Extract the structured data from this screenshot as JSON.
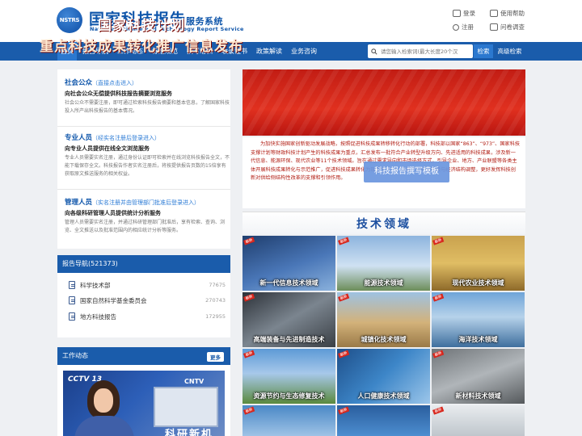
{
  "header": {
    "logo_text": "NSTRS",
    "title_main": "国家科技报告",
    "title_small": "服务系统",
    "subtitle": "National Science and Technology Report Service",
    "links": {
      "login": "登录",
      "help": "使用帮助",
      "register": "注册",
      "survey": "问卷调查"
    }
  },
  "nav": {
    "items": [
      "首页",
      "报告导航",
      "工作动态",
      "标准规范",
      "撰写培训",
      "收录证书",
      "政策解读",
      "业务咨询"
    ],
    "search_placeholder": "请您输入检索词(最大长度20个汉",
    "search_label": "检索",
    "advanced_label": "高级检索"
  },
  "access": {
    "public": {
      "title": "社会公众",
      "note": "（直接点击进入）",
      "head": "向社会公众无偿提供科技报告摘要浏览服务",
      "text": "社会公众不需要注册，即可通过检索科技报告摘要和基本信息，了解国家科技投入所产出科技报告的基本情况。"
    },
    "professional": {
      "title": "专业人员",
      "note": "（经实名注册后登录进入）",
      "head": "向专业人员提供在线全文浏览服务",
      "text": "专业人员需要实名注册，通过身份认证即可检索并在线浏览科技报告全文，不能下载保存全文。科技报告作者实名注册后，将按提供报告页数的15倍享有获取原文推送服务的相关权益。"
    },
    "manager": {
      "title": "管理人员",
      "note": "（实名注册并由管理部门批准后登录进入）",
      "head": "向各级科研管理人员提供统计分析服务",
      "text": "管理人员需要实名注册，并通过科研管理部门批准后，享有检索、查询、浏览、全文推送以及批准范围内的相应统计分析等服务。"
    }
  },
  "guide": {
    "title": "报告导航(521373)",
    "rows": [
      {
        "label": "科学技术部",
        "count": "77675"
      },
      {
        "label": "国家自然科学基金委员会",
        "count": "270743"
      },
      {
        "label": "地方科技报告",
        "count": "172955"
      }
    ]
  },
  "work": {
    "title": "工作动态",
    "more": "更多",
    "img_cctv": "CCTV 13",
    "img_cntv": "CNTV",
    "img_caption": "科研新机"
  },
  "banner": {
    "line1": "国家科技计划",
    "line2": "重点科技成果转化推广信息发布"
  },
  "intro": {
    "text": "为加快实施国家创新驱动发展战略，按照促进科技成果转移转化行动的部署，科技部以国家“863”、“973”、国家科技支撑计划等财政科技计划产生的科技成果为重点，汇总发布一批符合产业转型升级方向、先进适用的科技成果，涉及新一代信息、能源环保、现代农业等11个技术领域。旨在通过需求导向和市场选择方式，引导企业、地方、产业联盟等各类主体开展科技成果转化与示范推广，促进科技成果转化为现实生产力，支撑产业转型升级与经济结构调整，更好发挥科技创新对供给侧结构性改革的支撑和引领作用。",
    "template_button": "科技报告撰写模板"
  },
  "tech": {
    "title": "技术领域",
    "tag": "最新",
    "tiles": [
      "新一代信息技术领域",
      "能源技术领域",
      "现代农业技术领域",
      "高端装备与先进制造技术",
      "城镇化技术领域",
      "海洋技术领域",
      "资源节约与生态修复技术",
      "人口健康技术领域",
      "新材料技术领域",
      "",
      "",
      ""
    ]
  },
  "colors": {
    "nav_blue": "#1a5cab",
    "title_blue": "#0e55aa",
    "banner_red": "#c21d14",
    "intro_red": "#b21e14"
  }
}
